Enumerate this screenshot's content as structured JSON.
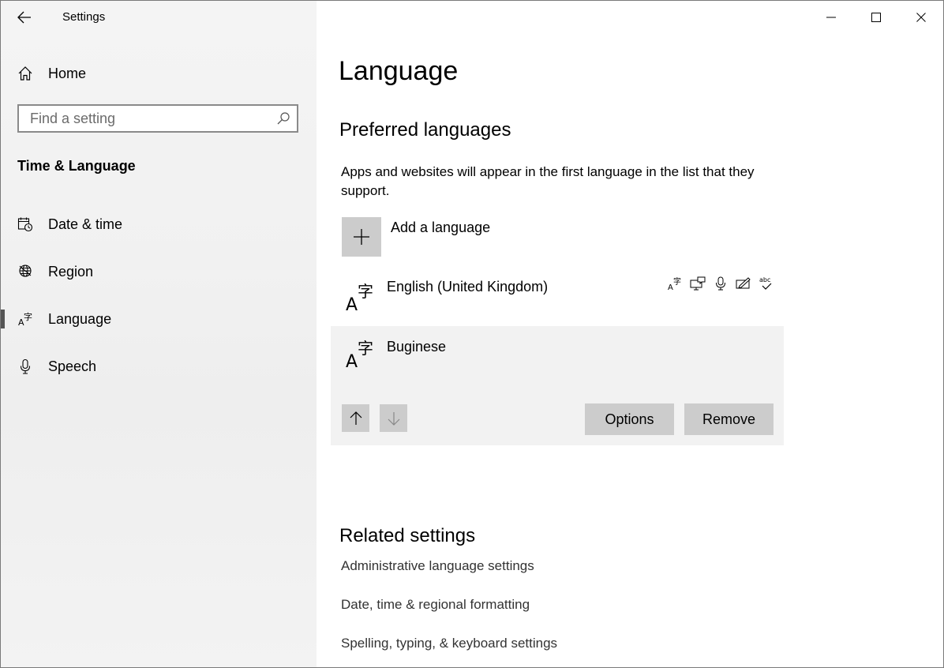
{
  "app": {
    "title": "Settings",
    "back_icon": "back-arrow-icon"
  },
  "window_controls": {
    "minimize_icon": "minimize-icon",
    "maximize_icon": "maximize-icon",
    "close_icon": "close-icon"
  },
  "sidebar": {
    "home": {
      "label": "Home",
      "icon": "home-icon"
    },
    "search": {
      "placeholder": "Find a setting",
      "value": "",
      "icon": "search-icon"
    },
    "section_title": "Time & Language",
    "items": [
      {
        "label": "Date & time",
        "icon": "calendar-clock-icon",
        "selected": false
      },
      {
        "label": "Region",
        "icon": "globe-icon",
        "selected": false
      },
      {
        "label": "Language",
        "icon": "language-icon",
        "selected": true
      },
      {
        "label": "Speech",
        "icon": "microphone-icon",
        "selected": false
      }
    ]
  },
  "main": {
    "title": "Language",
    "preferred": {
      "heading": "Preferred languages",
      "description": "Apps and websites will appear in the first language in the list that they support.",
      "add_label": "Add a language",
      "languages": [
        {
          "name": "English (United Kingdom)",
          "feature_icons": [
            "display-language-icon",
            "text-to-speech-icon",
            "speech-recognition-icon",
            "handwriting-icon",
            "spell-check-icon"
          ]
        },
        {
          "name": "Buginese",
          "selected": true
        }
      ],
      "buttons": {
        "options": "Options",
        "remove": "Remove",
        "move_up_icon": "arrow-up-icon",
        "move_down_icon": "arrow-down-icon"
      }
    },
    "related": {
      "heading": "Related settings",
      "links": [
        "Administrative language settings",
        "Date, time & regional formatting",
        "Spelling, typing, & keyboard settings"
      ]
    }
  },
  "colors": {
    "sidebar_bg": "#f2f2f2",
    "button_bg": "#cccccc",
    "selected_row_bg": "#f2f2f2",
    "selection_indicator": "#555555",
    "link_text": "#333333"
  }
}
